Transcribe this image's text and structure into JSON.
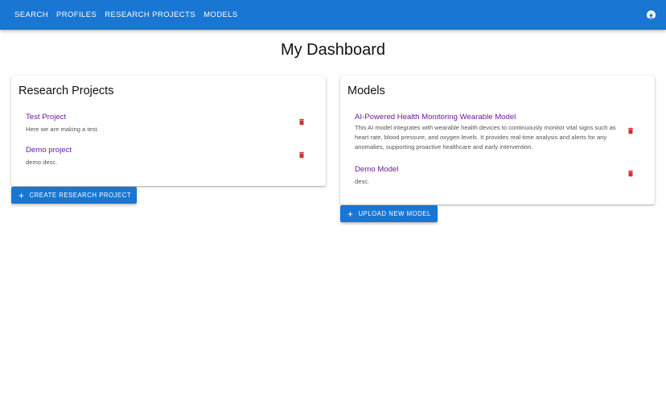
{
  "nav": {
    "items": [
      "SEARCH",
      "PROFILES",
      "RESEARCH PROJECTS",
      "MODELS"
    ]
  },
  "header": {
    "title": "My Dashboard"
  },
  "research_projects": {
    "title": "Research Projects",
    "items": [
      {
        "title": "Test Project",
        "desc": "Here we are making a test."
      },
      {
        "title": "Demo project",
        "desc": "demo desc."
      }
    ],
    "button": "CREATE RESEARCH PROJECT"
  },
  "models": {
    "title": "Models",
    "items": [
      {
        "title": "AI-Powered Health Monitoring Wearable Model",
        "desc": "This AI model integrates with wearable health devices to continuously monitor vital signs such as heart rate, blood pressure, and oxygen levels. It provides real-time analysis and alerts for any anomalies, supporting proactive healthcare and early intervention."
      },
      {
        "title": "Demo Model",
        "desc": "desc."
      }
    ],
    "button": "UPLOAD NEW MODEL"
  },
  "colors": {
    "appbar": "#1976d2",
    "link": "#6a1b9a",
    "delete": "#d32f2f"
  }
}
